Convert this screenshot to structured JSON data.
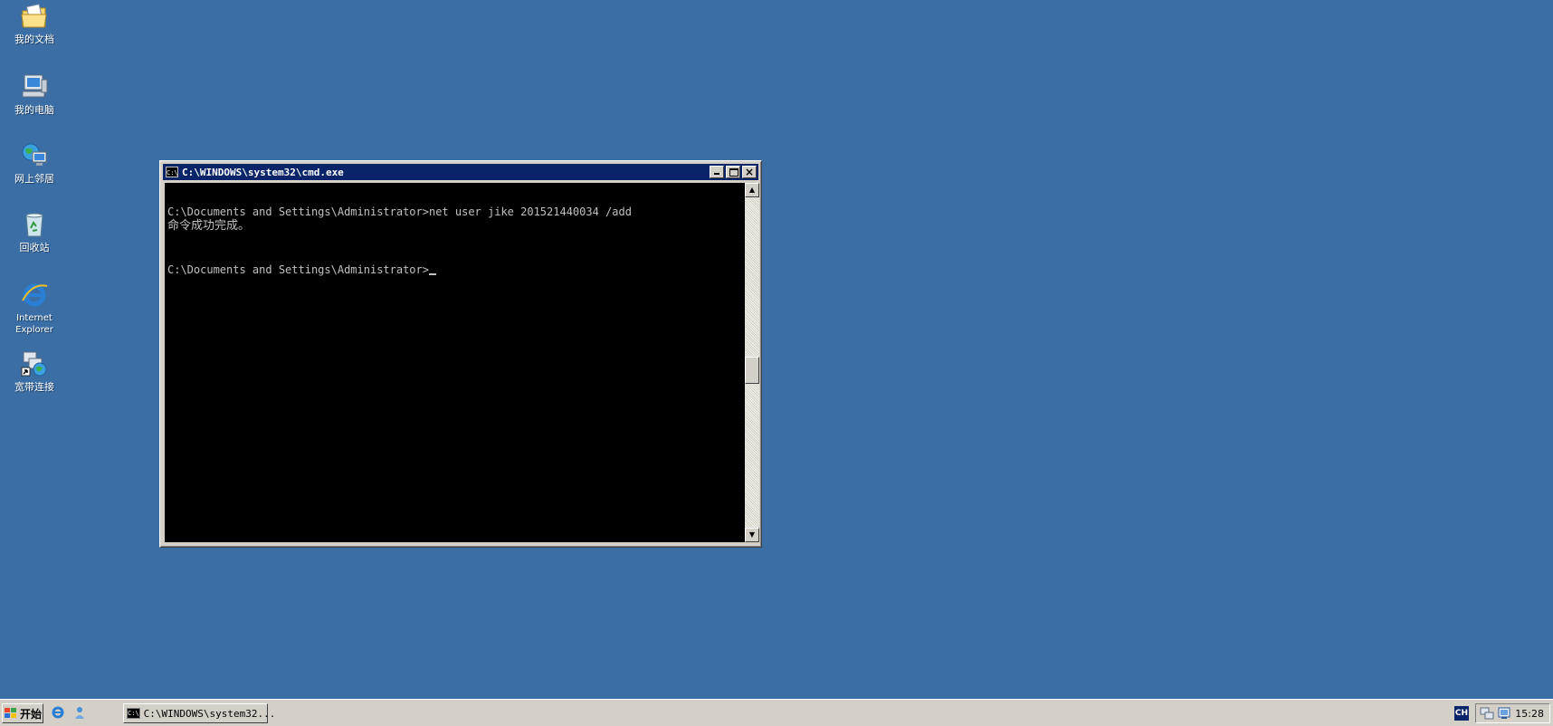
{
  "desktop": {
    "icons": [
      {
        "label": "我的文档",
        "icon": "folder-documents-icon"
      },
      {
        "label": "我的电脑",
        "icon": "computer-icon"
      },
      {
        "label": "网上邻居",
        "icon": "network-places-icon"
      },
      {
        "label": "回收站",
        "icon": "recycle-bin-icon"
      },
      {
        "label_line1": "Internet",
        "label_line2": "Explorer",
        "icon": "internet-explorer-icon"
      },
      {
        "label": "宽带连接",
        "icon": "broadband-connection-icon"
      }
    ]
  },
  "cmd_window": {
    "title": "C:\\WINDOWS\\system32\\cmd.exe",
    "icon_text": "C:\\",
    "lines": [
      "",
      "C:\\Documents and Settings\\Administrator>net user jike 201521440034 /add",
      "命令成功完成。",
      "",
      "",
      "C:\\Documents and Settings\\Administrator>"
    ]
  },
  "taskbar": {
    "start_label": "开始",
    "task_button_label": "C:\\WINDOWS\\system32...",
    "ime_label": "CH",
    "clock": "15:28"
  },
  "colors": {
    "desktop": "#3a6ea5",
    "title_active": "#0a246a",
    "chrome": "#d4d0c8",
    "console_bg": "#000000",
    "console_text": "#c0c0c0"
  }
}
